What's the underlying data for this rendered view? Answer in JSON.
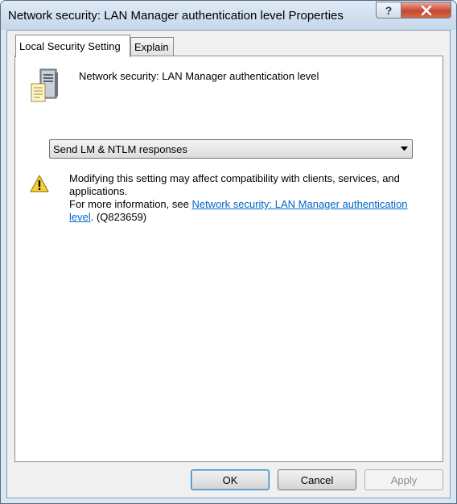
{
  "window": {
    "title": "Network security: LAN Manager authentication level Properties",
    "help_glyph": "?",
    "close_icon": "close-icon"
  },
  "tabs": [
    {
      "label": "Local Security Setting",
      "active": true
    },
    {
      "label": "Explain",
      "active": false
    }
  ],
  "policy": {
    "icon": "server-document-icon",
    "title": "Network security: LAN Manager authentication level"
  },
  "setting": {
    "selected": "Send LM & NTLM responses"
  },
  "warning": {
    "icon": "warning-icon",
    "line1": "Modifying this setting may affect compatibility with clients, services, and applications.",
    "line2_prefix": "For more information, see ",
    "link_text": "Network security: LAN Manager authentication level",
    "line2_suffix": ". (Q823659)"
  },
  "buttons": {
    "ok": "OK",
    "cancel": "Cancel",
    "apply": "Apply"
  },
  "colors": {
    "link": "#0066cc",
    "close_button": "#c8462f",
    "default_button_border": "#3c7fb1"
  }
}
